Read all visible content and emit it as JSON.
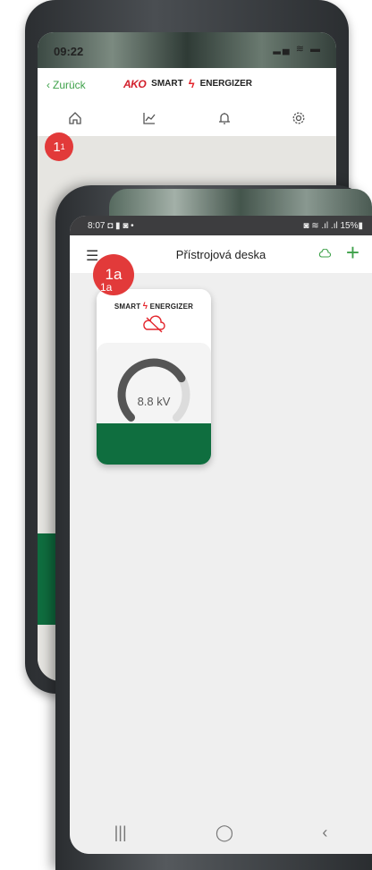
{
  "back_phone": {
    "status_time": "09:22",
    "status_icons": "▂▄ ≋ ▬",
    "back_label": "Zurück",
    "brand_ako": "AKO",
    "brand_smart": "SMART",
    "brand_energizer": "ENERGIZER",
    "tabs": [
      {
        "icon": "home-icon",
        "glyph": "⌂"
      },
      {
        "icon": "chart-icon",
        "glyph": "⟋"
      },
      {
        "icon": "bell-icon",
        "glyph": "⍾"
      },
      {
        "icon": "gear-icon",
        "glyph": "⚙"
      }
    ]
  },
  "badges": {
    "one": "1",
    "one_sup": "1",
    "one_a": "1a",
    "one_a_sub": "1a"
  },
  "front_phone": {
    "status_left": "8:07 ◘ ▮ ◙ •",
    "status_right": "◙ ≋ .ıl .ıl 15%▮",
    "title": "Přístrojová deska",
    "card": {
      "brand_smart": "SMART",
      "brand_energizer": "ENERGIZER",
      "value": "8.8 kV",
      "gauge_fraction": 0.72
    },
    "nav": [
      "|||",
      "◯",
      "‹"
    ]
  },
  "colors": {
    "accent_green": "#3ea14a",
    "card_green": "#0f6e3f",
    "badge_red": "#e23a3a",
    "brand_red": "#e3242b"
  }
}
